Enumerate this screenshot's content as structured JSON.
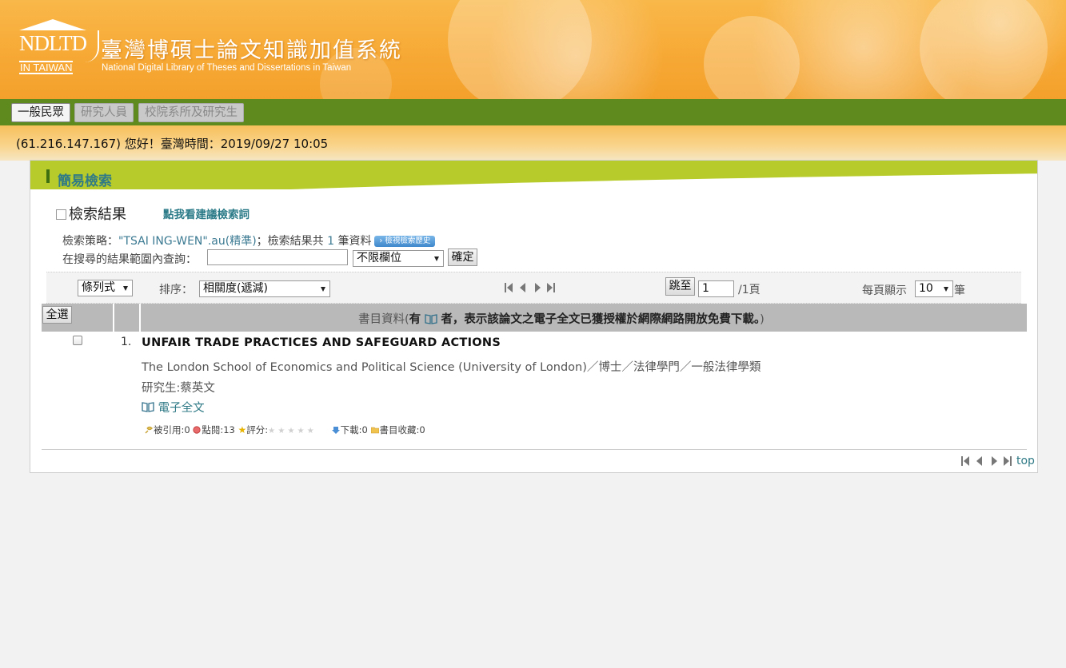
{
  "header": {
    "logo_text": "NDLTD",
    "logo_subtext": "IN TAIWAN",
    "title": "臺灣博碩士論文知識加值系統",
    "subtitle": "National Digital Library of Theses and Dissertations in Taiwan"
  },
  "nav": {
    "tabs": [
      {
        "label": "一般民眾",
        "active": true
      },
      {
        "label": "研究人員",
        "active": false
      },
      {
        "label": "校院系所及研究生",
        "active": false
      }
    ]
  },
  "greeting": "(61.216.147.167) 您好！臺灣時間：2019/09/27 10:05",
  "panel": {
    "title": "簡易檢索",
    "results_heading": "檢索結果",
    "suggest_link": "點我看建議檢索詞",
    "strategy_label": "檢索策略：",
    "strategy_query": "\"TSAI ING-WEN\".au(精準)",
    "result_count_prefix": "；檢索結果共",
    "result_count": "1",
    "result_count_suffix": "筆資料",
    "history_button": "檢視檢索歷史",
    "refine_label": "在搜尋的結果範圍內查詢：",
    "refine_value": "",
    "refine_field": "不限欄位",
    "confirm_button": "確定"
  },
  "toolbar": {
    "view_mode": "條列式",
    "sort_label": "排序：",
    "sort_value": "相關度(遞減)",
    "jump_button": "跳至",
    "page_input": "1",
    "page_total": "/1頁",
    "per_page_label": "每頁顯示",
    "per_page_value": "10",
    "per_page_suffix": "筆"
  },
  "table": {
    "select_all": "全選",
    "header_prefix": "書目資料(",
    "header_bold": "有",
    "header_bold2": "者，表示該論文之電子全文已獲授權於網際網路開放免費下載。",
    "header_suffix": ")"
  },
  "results": [
    {
      "number": "1.",
      "title": "UNFAIR TRADE PRACTICES AND SAFEGUARD ACTIONS",
      "school_info": "The London School of Economics and Political Science (University of London)／博士／法律學門／一般法律學類",
      "author": "研究生:蔡英文",
      "fulltext_label": "電子全文",
      "stats": {
        "cited_label": "被引用:",
        "cited": "0",
        "clicks_label": "點閱:",
        "clicks": "13",
        "rating_label": "評分:",
        "rating": 0,
        "downloads_label": "下載:",
        "downloads": "0",
        "bookmarks_label": "書目收藏:",
        "bookmarks": "0"
      }
    }
  ],
  "footer": {
    "top_link": "top"
  },
  "colors": {
    "nav_green": "#5f8a1d",
    "panel_head": "#b7cc2a",
    "link_teal": "#2f7a86",
    "header_orange": "#f7a935"
  }
}
